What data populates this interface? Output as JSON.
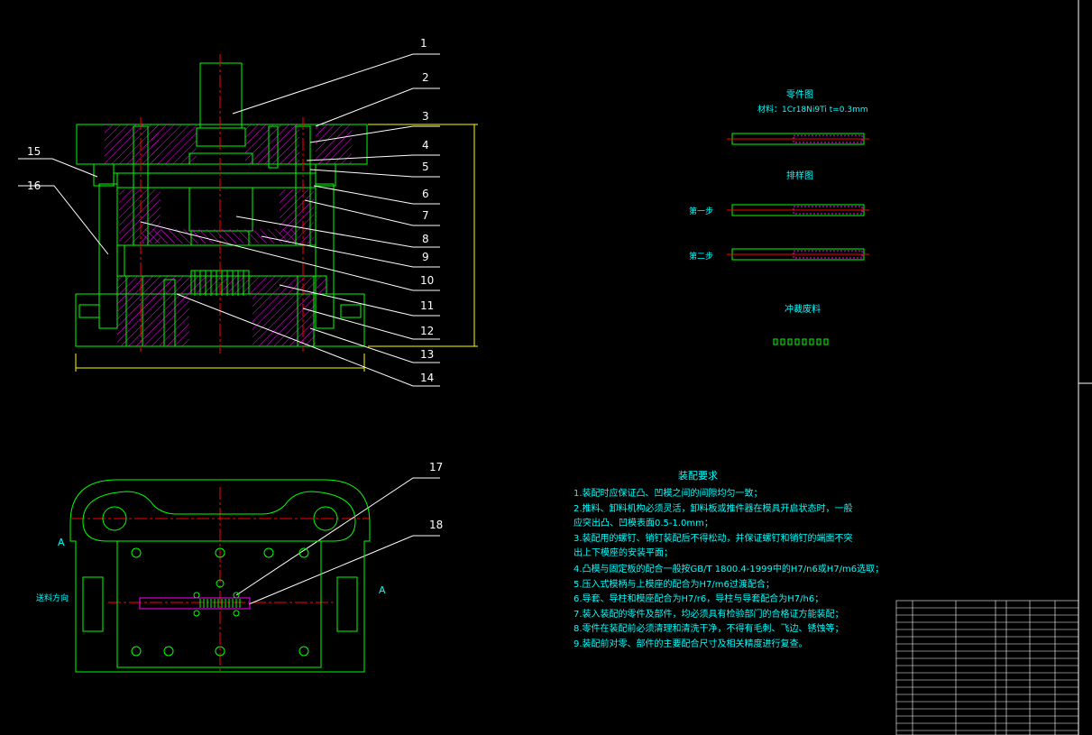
{
  "colors": {
    "background": "#000000",
    "outline": "#00ff00",
    "hatch": "#ff00ff",
    "centerline": "#ff0000",
    "leader": "#ffffff",
    "text": "#00ffff",
    "dimension": "#ffff00"
  },
  "part_numbers": [
    "1",
    "2",
    "3",
    "4",
    "5",
    "6",
    "7",
    "8",
    "9",
    "10",
    "11",
    "12",
    "13",
    "14",
    "15",
    "16",
    "17",
    "18"
  ],
  "view_labels": {
    "section_left": "A",
    "section_right": "A"
  },
  "feed_label": "送料方向",
  "part_drawing": {
    "title": "零件图",
    "material": "材料：1Cr18Ni9Ti  t=0.3mm"
  },
  "layout_drawing": {
    "title": "排样图",
    "step1": "第一步",
    "step2": "第二步"
  },
  "scrap_label": "冲裁废料",
  "requirements": {
    "title": "装配要求",
    "items": [
      "1.装配时应保证凸、凹模之间的间隙均匀一致；",
      "2.推料、卸料机构必须灵活，卸料板或推件器在模具开启状态时，一般",
      "   应突出凸、凹模表面0.5-1.0mm；",
      "3.装配用的螺钉、销钉装配后不得松动，并保证螺钉和销钉的端面不突",
      "   出上下模座的安装平面；",
      "4.凸模与固定板的配合一般按GB/T 1800.4-1999中的H7/n6或H7/m6选取；",
      "5.压入式模柄与上模座的配合为H7/m6过渡配合；",
      "6.导套、导柱和模座配合为H7/r6，导柱与导套配合为H7/h6；",
      "7.装入装配的零件及部件，均必须具有检验部门的合格证方能装配；",
      "8.零件在装配前必须清理和清洗干净，不得有毛刺、飞边、锈蚀等；",
      "9.装配前对零、部件的主要配合尺寸及相关精度进行复查。"
    ]
  }
}
